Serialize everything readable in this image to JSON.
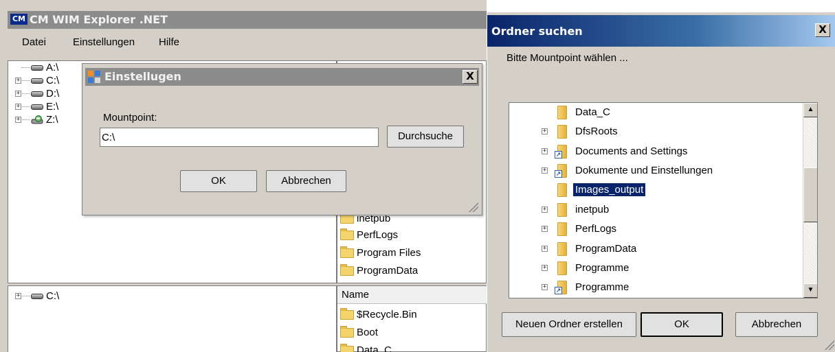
{
  "main_window": {
    "title": "CM WIM Explorer .NET",
    "logo_text": "CM",
    "menu": [
      "Datei",
      "Einstellungen",
      "Hilfe"
    ],
    "tree_top": [
      {
        "label": "A:\\",
        "expandable": false,
        "icon": "drive-icon"
      },
      {
        "label": "C:\\",
        "expandable": true,
        "icon": "drive-icon"
      },
      {
        "label": "D:\\",
        "expandable": true,
        "icon": "drive-icon"
      },
      {
        "label": "E:\\",
        "expandable": true,
        "icon": "drive-icon"
      },
      {
        "label": "Z:\\",
        "expandable": true,
        "icon": "network-drive-icon"
      }
    ],
    "tree_bottom": [
      {
        "label": "C:\\",
        "expandable": true,
        "icon": "drive-icon"
      }
    ],
    "list_top_items": [
      "inetpub",
      "PerfLogs",
      "Program Files",
      "ProgramData"
    ],
    "list_bottom": {
      "column_header": "Name",
      "items": [
        "$Recycle.Bin",
        "Boot",
        "Data_C"
      ]
    }
  },
  "settings_dialog": {
    "title": "Einstellugen",
    "mountpoint_label": "Mountpoint:",
    "mountpoint_value": "C:\\",
    "browse_button": "Durchsuche",
    "ok_button": "OK",
    "cancel_button": "Abbrechen",
    "close_symbol": "X"
  },
  "folder_dialog": {
    "title": "Ordner suchen",
    "close_symbol": "X",
    "prompt": "Bitte Mountpoint wählen ...",
    "folders": [
      {
        "name": "Data_C",
        "expandable": false,
        "shortcut": false,
        "selected": false
      },
      {
        "name": "DfsRoots",
        "expandable": true,
        "shortcut": false,
        "selected": false
      },
      {
        "name": "Documents and Settings",
        "expandable": true,
        "shortcut": true,
        "selected": false
      },
      {
        "name": "Dokumente und Einstellungen",
        "expandable": true,
        "shortcut": true,
        "selected": false
      },
      {
        "name": "Images_output",
        "expandable": false,
        "shortcut": false,
        "selected": true
      },
      {
        "name": "inetpub",
        "expandable": true,
        "shortcut": false,
        "selected": false
      },
      {
        "name": "PerfLogs",
        "expandable": true,
        "shortcut": false,
        "selected": false
      },
      {
        "name": "ProgramData",
        "expandable": true,
        "shortcut": false,
        "selected": false
      },
      {
        "name": "Programme",
        "expandable": true,
        "shortcut": false,
        "selected": false
      },
      {
        "name": "Programme",
        "expandable": true,
        "shortcut": true,
        "selected": false
      }
    ],
    "new_folder_button": "Neuen Ordner erstellen",
    "ok_button": "OK",
    "cancel_button": "Abbrechen"
  },
  "colors": {
    "inactive_title": "#8c8c8c",
    "active_title_start": "#0a246a",
    "active_title_end": "#a6caf0",
    "dialog_face": "#d4d0c8",
    "selection": "#0a246a"
  }
}
